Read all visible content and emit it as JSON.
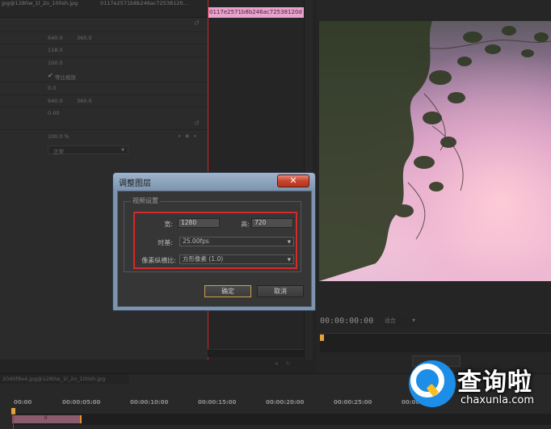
{
  "effect_panel": {
    "clip_tab": "jpg@1280w_1l_2o_100sh.jpg",
    "sequence_tab": "0117e2571b8b246ac72538120...",
    "rows": {
      "position": [
        "640.0",
        "360.0"
      ],
      "scale": "118.0",
      "scale_width": "100.0",
      "uniform_scale_label": "等比缩放",
      "rotation": "0.0",
      "anchor": [
        "640.0",
        "360.0"
      ],
      "anti_flicker": "0.00"
    },
    "opacity": "100.0 %",
    "blend_mode": "正常"
  },
  "mini_timeline": {
    "clip_name": "0117e2571b8b246ac72538120d"
  },
  "monitor": {
    "timecode": "00:00:00:00",
    "fit_select": "适合"
  },
  "timeline": {
    "tab": "20d0f8e4.jpg@1280w_1l_2o_100sh.jpg",
    "ticks": [
      "00:00",
      "00:00:05:00",
      "00:00:10:00",
      "00:00:15:00",
      "00:00:20:00",
      "00:00:25:00",
      "00:00:30:00"
    ],
    "workarea_marker": "II"
  },
  "dialog": {
    "title": "调整图层",
    "close_glyph": "✕",
    "group_label": "视频设置",
    "width_label": "宽:",
    "width_value": "1280",
    "height_label": "高:",
    "height_value": "720",
    "timebase_label": "时基:",
    "timebase_value": "25.00fps",
    "pixel_aspect_label": "像素纵横比:",
    "pixel_aspect_value": "方形像素 (1.0)",
    "ok_label": "确定",
    "cancel_label": "取消"
  },
  "watermark": {
    "cn": "查询啦",
    "en": "chaxunla.com"
  },
  "icons": {
    "undo": "undo-icon",
    "check": "checkmark-icon",
    "dropdown": "chevron-down-icon"
  },
  "colors": {
    "playhead": "#c22a2a",
    "highlight": "#d42a2a",
    "clip": "#e7a3cc",
    "marker": "#e3a33a",
    "watermark_blue": "#1c8ee8"
  }
}
